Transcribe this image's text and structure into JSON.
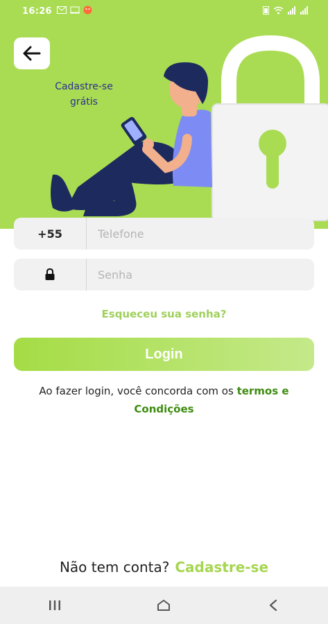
{
  "status_bar": {
    "time": "16:26"
  },
  "header": {
    "signup_free_line1": "Cadastre-se",
    "signup_free_line2": "grátis"
  },
  "form": {
    "phone_prefix": "+55",
    "phone_placeholder": "Telefone",
    "password_placeholder": "Senha",
    "forgot_password": "Esqueceu sua senha?",
    "login_button": "Login"
  },
  "terms": {
    "text_before": "Ao fazer login, você concorda com os ",
    "link_part1": "termos e",
    "link_part2": "Condições"
  },
  "footer": {
    "no_account": "Não tem conta?",
    "signup_link": "Cadastre-se"
  },
  "colors": {
    "hero_green": "#a9dc53",
    "accent_green": "#a5d64f",
    "link_dark_green": "#3e8c10",
    "title_blue": "#2d2f8f"
  },
  "icons": [
    "back-arrow-icon",
    "lock-icon",
    "nav-recents-icon",
    "nav-home-icon",
    "nav-back-icon"
  ]
}
